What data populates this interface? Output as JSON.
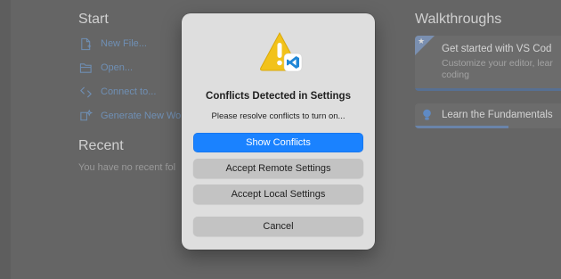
{
  "background": {
    "start": {
      "title": "Start",
      "items": [
        {
          "label": "New File...",
          "icon": "new-file-icon"
        },
        {
          "label": "Open...",
          "icon": "folder-open-icon"
        },
        {
          "label": "Connect to...",
          "icon": "remote-connect-icon"
        },
        {
          "label": "Generate New Wo",
          "icon": "sparkle-icon"
        }
      ]
    },
    "recent": {
      "title": "Recent",
      "text": "You have no recent fol"
    },
    "walkthroughs": {
      "title": "Walkthroughs",
      "cards": [
        {
          "title": "Get started with VS Cod",
          "description": "Customize your editor, lear coding",
          "icon": "star-icon"
        },
        {
          "title": "Learn the Fundamentals",
          "icon": "lightbulb-icon",
          "progress": 0.62
        }
      ]
    }
  },
  "dialog": {
    "icon": "warning-vscode-icon",
    "title": "Conflicts Detected in Settings",
    "message": "Please resolve conflicts to turn on...",
    "buttons": {
      "show_conflicts": "Show Conflicts",
      "accept_remote": "Accept Remote Settings",
      "accept_local": "Accept Local Settings",
      "cancel": "Cancel"
    }
  },
  "colors": {
    "overlay_bg": "#656565",
    "dialog_bg": "#dedede",
    "primary_button": "#1a82ff",
    "secondary_button": "#c3c3c3",
    "link_text": "#6f8fb4",
    "warning_yellow": "#f2c21a",
    "vscode_blue": "#1f86d6"
  }
}
